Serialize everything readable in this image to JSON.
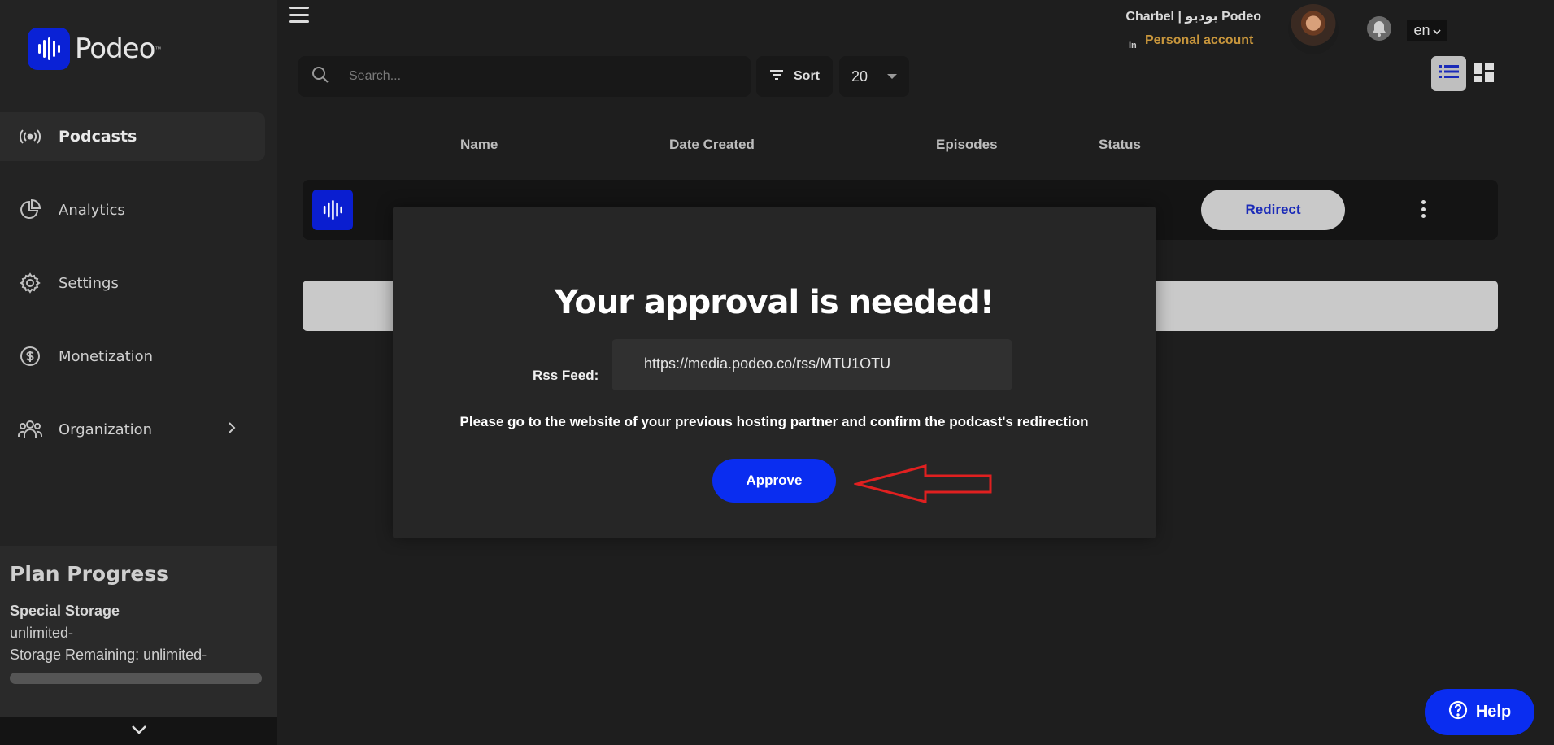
{
  "brand": {
    "name": "Podeo",
    "tm": "™",
    "color": "#0a22d6"
  },
  "sidebar": {
    "items": [
      {
        "label": "Podcasts",
        "icon": "broadcast-icon",
        "active": true
      },
      {
        "label": "Analytics",
        "icon": "pie-chart-icon"
      },
      {
        "label": "Settings",
        "icon": "gear-icon"
      },
      {
        "label": "Monetization",
        "icon": "dollar-circle-icon"
      },
      {
        "label": "Organization",
        "icon": "team-icon",
        "has_submenu": true
      }
    ],
    "plan": {
      "title": "Plan Progress",
      "subtitle": "Special Storage",
      "line1": "unlimited-",
      "line2": "Storage Remaining: unlimited-"
    }
  },
  "header": {
    "user_name": "Charbel | بوديو Podeo",
    "in_label": "In",
    "account": "Personal account",
    "language": "en"
  },
  "toolbar": {
    "search_placeholder": "Search...",
    "sort_label": "Sort",
    "per_page": "20"
  },
  "table": {
    "columns": [
      "Name",
      "Date Created",
      "Episodes",
      "Status"
    ],
    "row": {
      "action_label": "Redirect"
    }
  },
  "modal": {
    "title": "Your approval is needed!",
    "rss_label": "Rss Feed:",
    "rss_value": "https://media.podeo.co/rss/MTU1OTU",
    "message": "Please go to the website of your previous hosting partner and confirm the podcast's redirection",
    "approve_label": "Approve"
  },
  "help": {
    "label": "Help"
  },
  "colors": {
    "accent": "#0a2df0",
    "account": "#c8963c",
    "annotation_arrow": "#e02020"
  }
}
